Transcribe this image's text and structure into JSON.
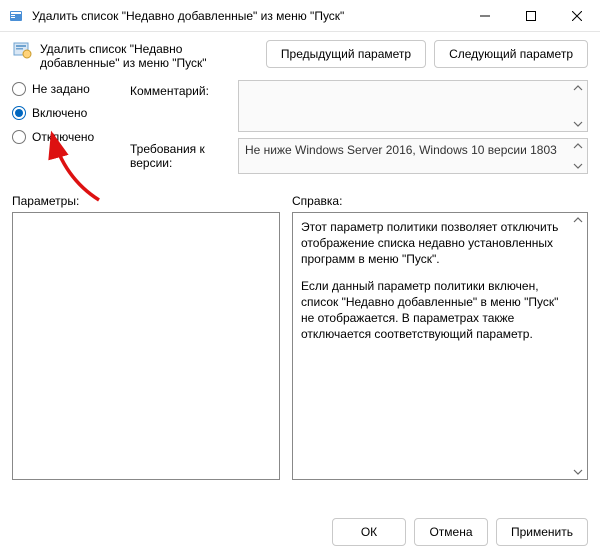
{
  "window": {
    "title": "Удалить список \"Недавно добавленные\" из меню \"Пуск\""
  },
  "header": {
    "policy_title": "Удалить список \"Недавно добавленные\" из меню \"Пуск\"",
    "prev_btn": "Предыдущий параметр",
    "next_btn": "Следующий параметр"
  },
  "radios": {
    "not_configured": "Не задано",
    "enabled": "Включено",
    "disabled": "Отключено"
  },
  "fields": {
    "comment_label": "Комментарий:",
    "requirements_label": "Требования к версии:",
    "requirements_value": "Не ниже Windows Server 2016, Windows 10 версии 1803"
  },
  "sections": {
    "parameters_label": "Параметры:",
    "help_label": "Справка:"
  },
  "help": {
    "p1": "Этот параметр политики позволяет отключить отображение списка недавно установленных программ в меню \"Пуск\".",
    "p2": "Если данный параметр политики включен, список \"Недавно добавленные\" в меню \"Пуск\" не отображается.  В параметрах также отключается соответствующий параметр."
  },
  "footer": {
    "ok": "ОК",
    "cancel": "Отмена",
    "apply": "Применить"
  }
}
